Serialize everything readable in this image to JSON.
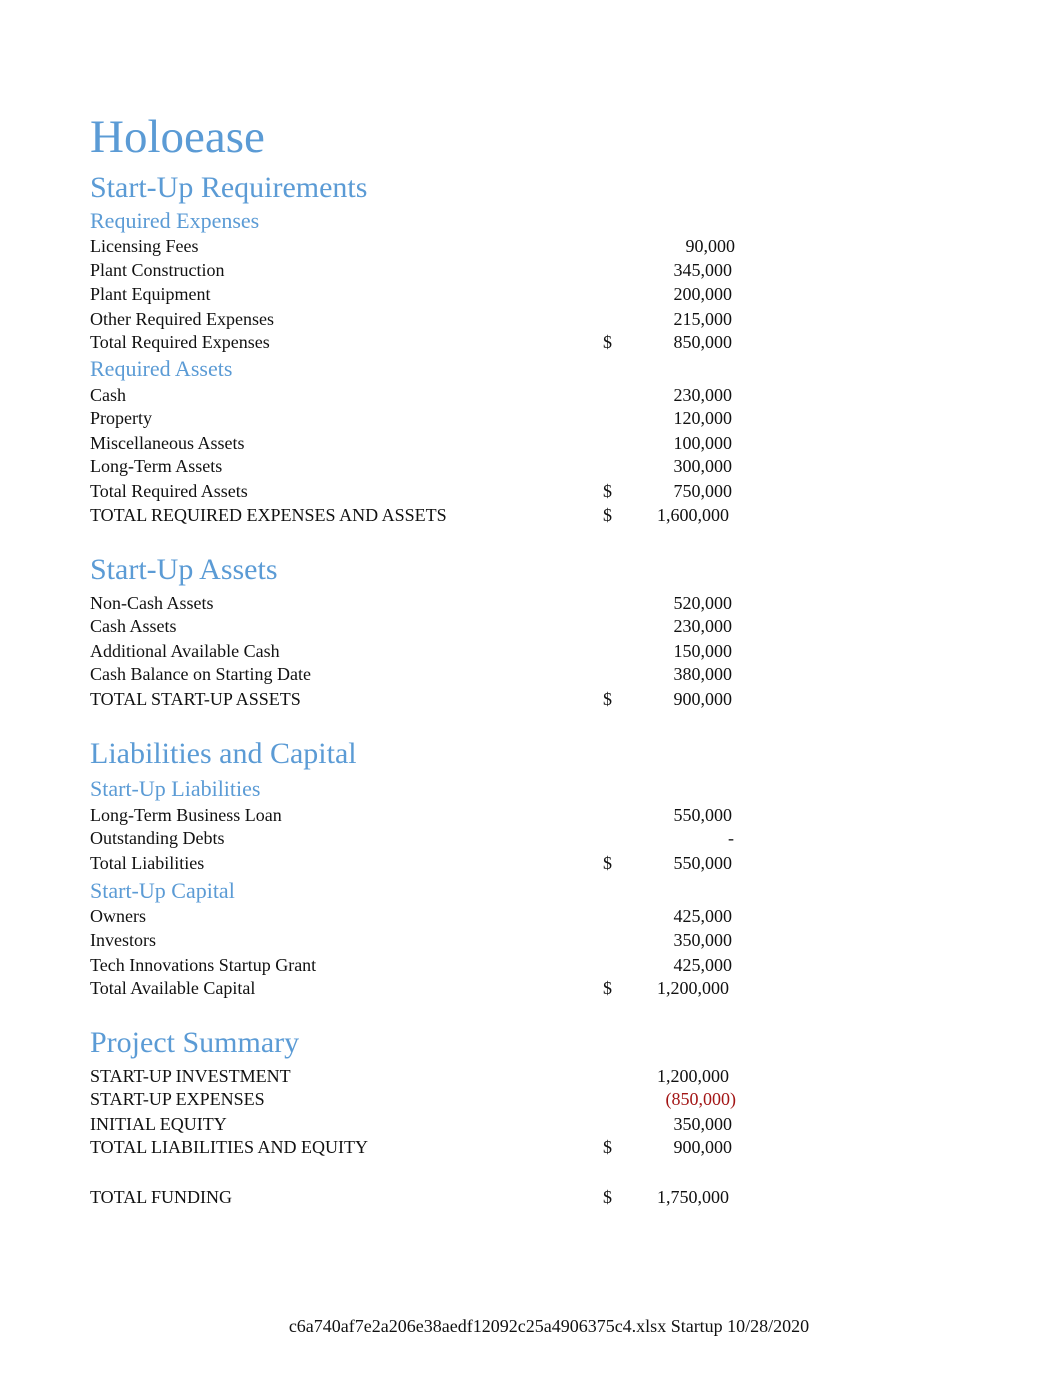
{
  "company": "Holoease",
  "sections": {
    "startup_requirements": {
      "title": "Start-Up Requirements",
      "required_expenses": {
        "title": "Required Expenses",
        "rows": [
          {
            "label": "Licensing Fees",
            "value": "90,000"
          },
          {
            "label": "Plant Construction",
            "value": "345,000"
          },
          {
            "label": "Plant Equipment",
            "value": "200,000"
          },
          {
            "label": "Other Required Expenses",
            "value": "215,000"
          }
        ],
        "total": {
          "label": "Total Required Expenses",
          "currency": "$",
          "value": "850,000"
        }
      },
      "required_assets": {
        "title": "Required Assets",
        "rows": [
          {
            "label": "Cash",
            "value": "230,000"
          },
          {
            "label": "Property",
            "value": "120,000"
          },
          {
            "label": "Miscellaneous Assets",
            "value": "100,000"
          },
          {
            "label": "Long-Term Assets",
            "value": "300,000",
            "highlight": "#c4dcb4"
          }
        ],
        "total": {
          "label": "Total Required Assets",
          "currency": "$",
          "value": "750,000"
        }
      },
      "grand_total": {
        "label": "TOTAL REQUIRED EXPENSES AND ASSETS",
        "currency": "$",
        "value": "1,600,000"
      }
    },
    "startup_assets": {
      "title": "Start-Up Assets",
      "rows": [
        {
          "label": "Non-Cash Assets",
          "value": "520,000"
        },
        {
          "label": "Cash Assets",
          "value": "230,000"
        },
        {
          "label": "Additional Available Cash",
          "value": "150,000"
        },
        {
          "label": "Cash Balance on Starting Date",
          "value": "380,000"
        }
      ],
      "total": {
        "label": "TOTAL START-UP ASSETS",
        "currency": "$",
        "value": "900,000"
      }
    },
    "liabilities_capital": {
      "title": "Liabilities and Capital",
      "liabilities": {
        "title": "Start-Up Liabilities",
        "rows": [
          {
            "label": "Long-Term Business Loan",
            "value": "550,000",
            "highlight": "#c4dcb4"
          },
          {
            "label": "Outstanding Debts",
            "value": "-"
          }
        ],
        "total": {
          "label": "Total Liabilities",
          "currency": "$",
          "value": "550,000"
        }
      },
      "capital": {
        "title": "Start-Up Capital",
        "rows": [
          {
            "label": "Owners",
            "value": "425,000"
          },
          {
            "label": "Investors",
            "value": "350,000",
            "highlight": "#c4dcb4"
          },
          {
            "label": "Tech Innovations Startup Grant",
            "value": "425,000"
          }
        ],
        "total": {
          "label": "Total Available Capital",
          "currency": "$",
          "value": "1,200,000"
        }
      }
    },
    "project_summary": {
      "title": "Project Summary",
      "rows": [
        {
          "label": "START-UP INVESTMENT",
          "value": "1,200,000"
        },
        {
          "label": "START-UP EXPENSES",
          "value": "(850,000)",
          "negative": true
        },
        {
          "label": "INITIAL EQUITY",
          "value": "350,000"
        }
      ],
      "total": {
        "label": "TOTAL LIABILITIES AND EQUITY",
        "currency": "$",
        "value": "900,000"
      },
      "funding": {
        "label": "TOTAL FUNDING",
        "currency": "$",
        "value": "1,750,000"
      }
    }
  },
  "colors": {
    "heading": "#5b9bd5",
    "negative": "#a31515",
    "input_highlight": "#c4dcb4"
  },
  "footer": "c6a740af7e2a206e38aedf12092c25a4906375c4.xlsx Startup 10/28/2020"
}
